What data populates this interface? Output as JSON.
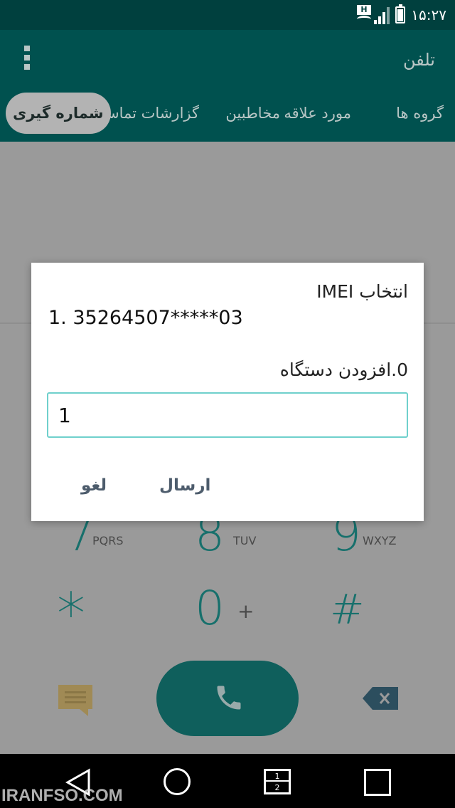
{
  "status_bar": {
    "time": "۱۵:۲۷",
    "network_badge": "H"
  },
  "app_bar": {
    "title": "تلفن"
  },
  "tabs": [
    {
      "label": "گروه ها"
    },
    {
      "label": "مورد علاقه"
    },
    {
      "label": "مخاطبین"
    },
    {
      "label": "گزارشات تماس"
    },
    {
      "label": "شماره گیری",
      "active": true
    }
  ],
  "dialpad": {
    "keys": [
      {
        "digit": "7",
        "letters": "PQRS"
      },
      {
        "digit": "8",
        "letters": "TUV"
      },
      {
        "digit": "9",
        "letters": "WXYZ"
      },
      {
        "digit": "*",
        "letters": ""
      },
      {
        "digit": "0",
        "letters": "+"
      },
      {
        "digit": "#",
        "letters": ""
      }
    ]
  },
  "dialog": {
    "title": "انتخاب IMEI",
    "imei_option": "1. 35264507*****03",
    "add_device_option": "0.افزودن دستگاه",
    "input_value": "1",
    "send_label": "ارسال",
    "cancel_label": "لغو"
  },
  "nav_bar": {
    "dual_top": "1",
    "dual_bottom": "2"
  },
  "watermark": "IRANFSO.COM",
  "colors": {
    "status_bar": "#00403e",
    "app_bar": "#00514f",
    "accent": "#17706c",
    "input_border": "#6fd0cc"
  }
}
